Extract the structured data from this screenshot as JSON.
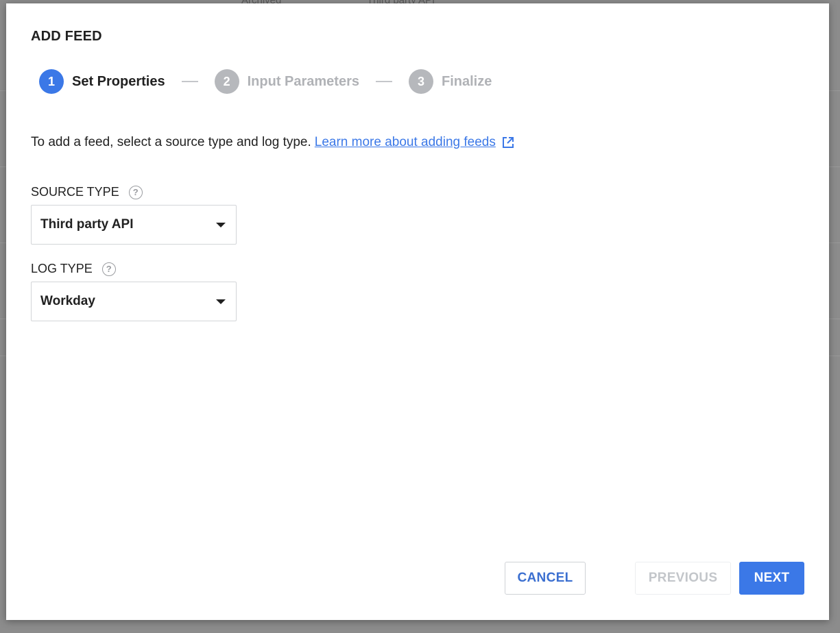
{
  "background": {
    "row_texts": [
      "Archived",
      "Third party API"
    ]
  },
  "dialog": {
    "title": "ADD FEED",
    "steps": [
      {
        "number": "1",
        "label": "Set Properties",
        "state": "active"
      },
      {
        "number": "2",
        "label": "Input Parameters",
        "state": "inactive"
      },
      {
        "number": "3",
        "label": "Finalize",
        "state": "inactive"
      }
    ],
    "intro_text": "To add a feed, select a source type and log type.",
    "intro_link": "Learn more about adding feeds",
    "fields": {
      "source_type": {
        "label": "SOURCE TYPE",
        "value": "Third party API"
      },
      "log_type": {
        "label": "LOG TYPE",
        "value": "Workday"
      }
    },
    "buttons": {
      "cancel": "CANCEL",
      "previous": "PREVIOUS",
      "next": "NEXT"
    }
  },
  "colors": {
    "accent": "#3b78e7",
    "inactive_step": "#b6b8bc"
  }
}
